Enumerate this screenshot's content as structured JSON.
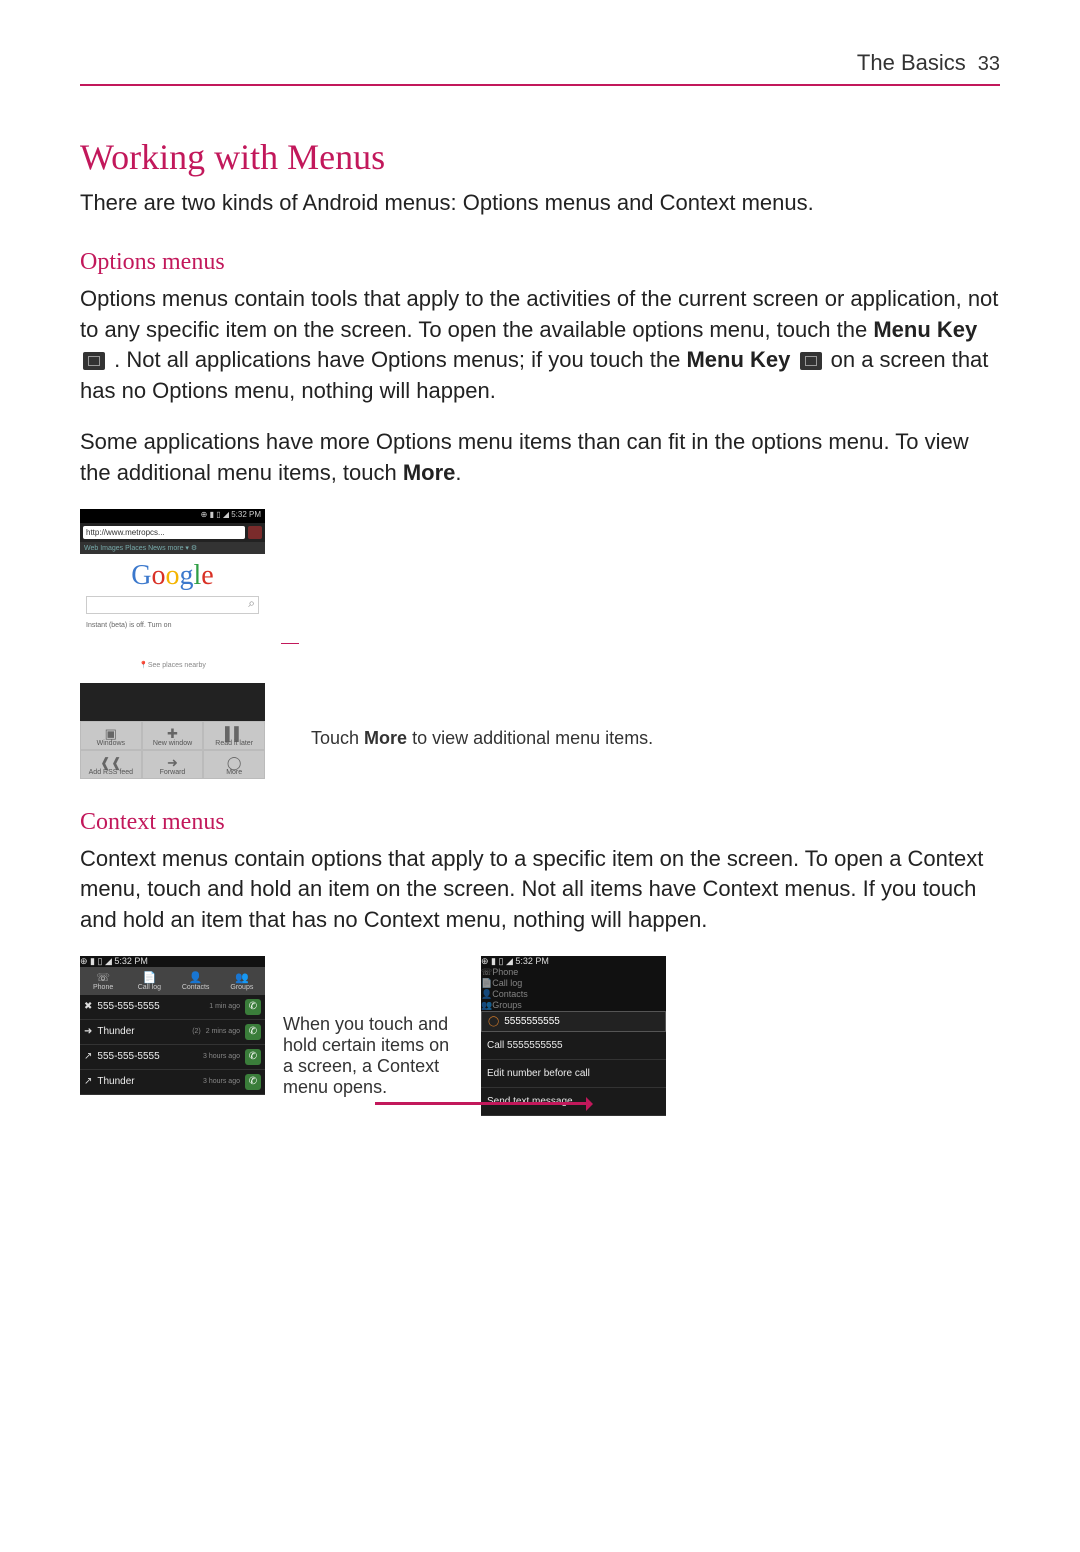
{
  "header": {
    "section": "The Basics",
    "page": "33"
  },
  "title": "Working with Menus",
  "intro": "There are two kinds of Android menus: Options menus and Context menus.",
  "options": {
    "heading": "Options menus",
    "p1a": "Options menus contain tools that apply to the activities of the current screen or application, not to any specific item on the screen. To open the available options menu, touch the ",
    "menu_key": "Menu Key",
    "p1b": ". Not all applications have Options menus; if you touch the ",
    "p1c": " on a screen that has no Options menu, nothing will happen.",
    "p2a": "Some applications have more Options menu items than can fit in the options menu. To view the additional menu items, touch ",
    "more": "More",
    "p2b": "."
  },
  "shot1": {
    "status_time": "5:32 PM",
    "url": "http://www.metropcs...",
    "top_links": "Web  Images  Places  News  more ▾  ⚙",
    "logo": "Google",
    "instant": "Instant (beta) is off. Turn on",
    "nearby": "📍See places nearby",
    "menu": [
      "Windows",
      "New window",
      "Read it later",
      "Add RSS feed",
      "Forward",
      "More"
    ]
  },
  "callout1a": "Touch ",
  "callout1b": " to view additional menu items.",
  "context": {
    "heading": "Context menus",
    "p": "Context menus contain options that apply to a specific item on the screen. To open a Context menu, touch and hold an item on the screen. Not all items have Context menus. If you touch and hold an item that has no Context menu, nothing will happen."
  },
  "shot2": {
    "status_time": "5:32 PM",
    "tabs": [
      "Phone",
      "Call log",
      "Contacts",
      "Groups"
    ],
    "rows": [
      {
        "icon": "✖",
        "num": "555-555-5555",
        "time": "1 min ago"
      },
      {
        "icon": "➜",
        "num": "Thunder",
        "extra": "(2)",
        "time": "2 mins ago"
      },
      {
        "icon": "↗",
        "num": "555-555-5555",
        "time": "3 hours ago"
      },
      {
        "icon": "↗",
        "num": "Thunder",
        "time": "3 hours ago"
      }
    ]
  },
  "callout2": "When you touch and hold certain items on a screen, a Context menu opens.",
  "shot3": {
    "status_time": "5:32 PM",
    "tabs": [
      "Phone",
      "Call log",
      "Contacts",
      "Groups"
    ],
    "header_num": "5555555555",
    "items": [
      "Call 5555555555",
      "Edit number before call",
      "Send text message"
    ]
  }
}
